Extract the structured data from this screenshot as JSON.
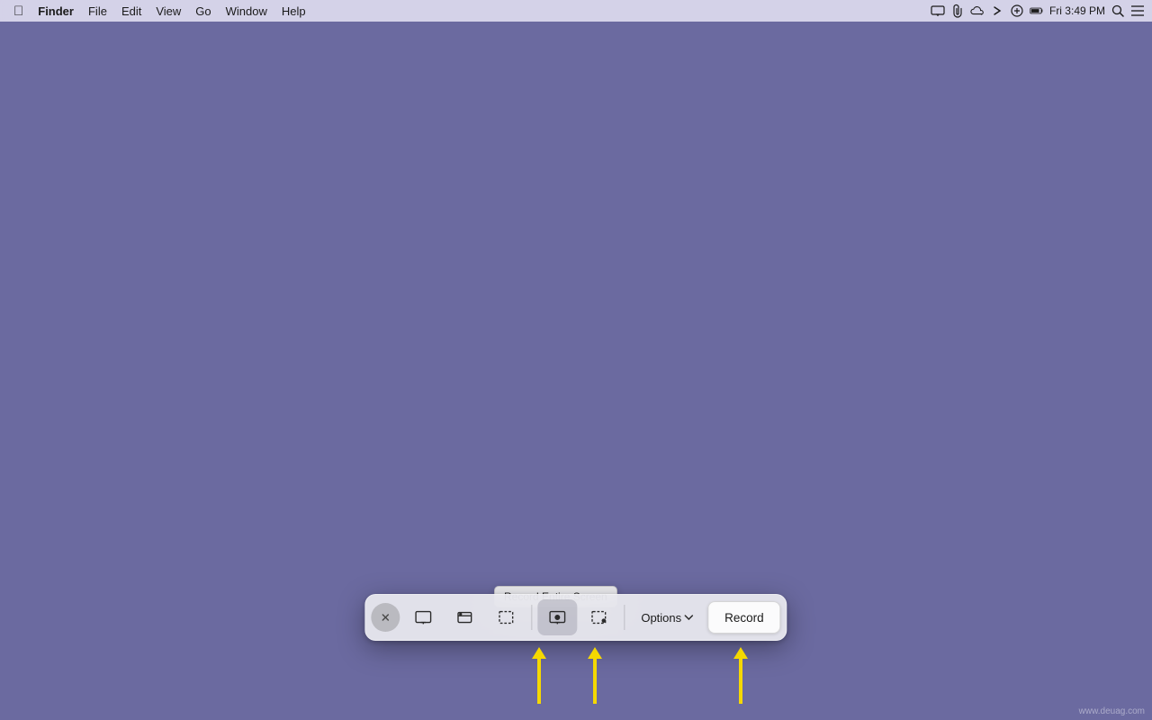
{
  "menubar": {
    "apple_label": "",
    "items": [
      {
        "label": "Finder",
        "bold": true
      },
      {
        "label": "File"
      },
      {
        "label": "Edit"
      },
      {
        "label": "View"
      },
      {
        "label": "Go"
      },
      {
        "label": "Window"
      },
      {
        "label": "Help"
      }
    ],
    "time": "Fri 3:49 PM",
    "icons": [
      {
        "name": "screen-icon",
        "symbol": "▭"
      },
      {
        "name": "paperclip-icon",
        "symbol": "📎"
      },
      {
        "name": "cloudy-icon",
        "symbol": "☁"
      },
      {
        "name": "bluetooth-icon",
        "symbol": "⌘"
      },
      {
        "name": "link-icon",
        "symbol": "🔗"
      },
      {
        "name": "battery-icon",
        "symbol": "▮▮▮"
      },
      {
        "name": "search-icon",
        "symbol": "🔍"
      },
      {
        "name": "list-icon",
        "symbol": "☰"
      }
    ]
  },
  "desktop": {
    "background_color": "#6b6aa0"
  },
  "tooltip": {
    "text": "Record Entire Screen"
  },
  "toolbar": {
    "buttons": [
      {
        "name": "screenshot-window-btn",
        "icon": "window",
        "active": false
      },
      {
        "name": "screenshot-window2-btn",
        "icon": "window2",
        "active": false
      },
      {
        "name": "screenshot-selection-btn",
        "icon": "selection",
        "active": false
      },
      {
        "name": "record-screen-btn",
        "icon": "record-screen",
        "active": true
      },
      {
        "name": "record-selection-btn",
        "icon": "record-selection",
        "active": false
      }
    ],
    "options_label": "Options",
    "record_label": "Record"
  },
  "arrows": [
    {
      "id": "arrow1",
      "color": "#f5d800"
    },
    {
      "id": "arrow2",
      "color": "#f5d800"
    },
    {
      "id": "arrow3",
      "color": "#f5d800"
    }
  ],
  "watermark": "www.deuag.com"
}
